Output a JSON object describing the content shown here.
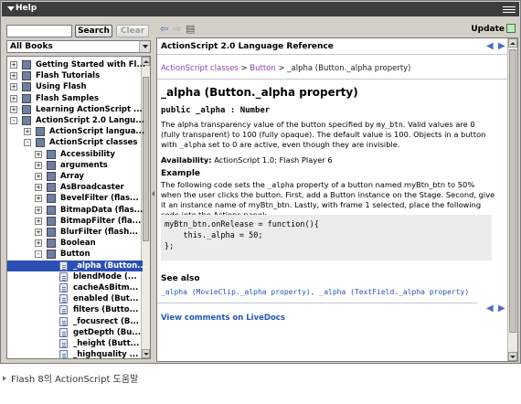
{
  "window": {
    "title": "Help"
  },
  "search": {
    "value": "",
    "search_label": "Search",
    "clear_label": "Clear"
  },
  "book_select": {
    "value": "All Books"
  },
  "tree": [
    {
      "label": "Getting Started with Fl...",
      "level": 0,
      "exp": "+",
      "icon": "book-icon"
    },
    {
      "label": "Flash Tutorials",
      "level": 0,
      "exp": "+",
      "icon": "book-icon"
    },
    {
      "label": "Using Flash",
      "level": 0,
      "exp": "+",
      "icon": "book-icon"
    },
    {
      "label": "Flash Samples",
      "level": 0,
      "exp": "+",
      "icon": "book-icon"
    },
    {
      "label": "Learning ActionScript ...",
      "level": 0,
      "exp": "+",
      "icon": "book-icon"
    },
    {
      "label": "ActionScript 2.0 Langu...",
      "level": 0,
      "exp": "-",
      "icon": "book-icon"
    },
    {
      "label": "ActionScript langua...",
      "level": 1,
      "exp": "+",
      "icon": "book-icon"
    },
    {
      "label": "ActionScript classes",
      "level": 1,
      "exp": "-",
      "icon": "book-icon"
    },
    {
      "label": "Accessibility",
      "level": 2,
      "exp": "+",
      "icon": "book-icon"
    },
    {
      "label": "arguments",
      "level": 2,
      "exp": "+",
      "icon": "book-icon"
    },
    {
      "label": "Array",
      "level": 2,
      "exp": "+",
      "icon": "book-icon"
    },
    {
      "label": "AsBroadcaster",
      "level": 2,
      "exp": "+",
      "icon": "book-icon"
    },
    {
      "label": "BevelFilter (flas...",
      "level": 2,
      "exp": "+",
      "icon": "book-icon"
    },
    {
      "label": "BitmapData (flas...",
      "level": 2,
      "exp": "+",
      "icon": "book-icon"
    },
    {
      "label": "BitmapFilter (fla...",
      "level": 2,
      "exp": "+",
      "icon": "book-icon"
    },
    {
      "label": "BlurFilter (flash...",
      "level": 2,
      "exp": "+",
      "icon": "book-icon"
    },
    {
      "label": "Boolean",
      "level": 2,
      "exp": "+",
      "icon": "book-icon"
    },
    {
      "label": "Button",
      "level": 2,
      "exp": "-",
      "icon": "book-icon"
    },
    {
      "label": "_alpha (Button...",
      "level": 3,
      "exp": "",
      "icon": "page-icon",
      "selected": true
    },
    {
      "label": "blendMode (...",
      "level": 3,
      "exp": "",
      "icon": "page-icon"
    },
    {
      "label": "cacheAsBitm...",
      "level": 3,
      "exp": "",
      "icon": "page-icon"
    },
    {
      "label": "enabled (But...",
      "level": 3,
      "exp": "",
      "icon": "page-icon"
    },
    {
      "label": "filters (Butto...",
      "level": 3,
      "exp": "",
      "icon": "page-icon"
    },
    {
      "label": "_focusrect (B...",
      "level": 3,
      "exp": "",
      "icon": "page-icon"
    },
    {
      "label": "getDepth (Bu...",
      "level": 3,
      "exp": "",
      "icon": "page-icon"
    },
    {
      "label": "_height (Butt...",
      "level": 3,
      "exp": "",
      "icon": "page-icon"
    },
    {
      "label": "_highquality ...",
      "level": 3,
      "exp": "",
      "icon": "page-icon"
    }
  ],
  "toolbar": {
    "update_label": "Update"
  },
  "doc": {
    "book_title": "ActionScript 2.0 Language Reference",
    "breadcrumb": {
      "part1": "ActionScript classes",
      "sep": ">",
      "part2": "Button",
      "current": "_alpha (Button._alpha property)"
    },
    "heading": "_alpha (Button._alpha property)",
    "signature": "public _alpha : Number",
    "desc": {
      "t1": "The alpha transparency value of the button specified by ",
      "c1": "my_btn",
      "t2": ". Valid values are 0 (fully transparent) to 100 (fully opaque). The default value is 100. Objects in a button with ",
      "c2": "_alpha",
      "t3": " set to 0 are active, even though they are invisible."
    },
    "availability_label": "Availability:",
    "availability_text": "ActionScript 1.0; Flash Player 6",
    "example_heading": "Example",
    "example": {
      "t1": "The following code sets the ",
      "c1": "_alpha",
      "t2": " property of a button named myBtn_btn to 50% when the user clicks the button. First, add a Button instance on the Stage. Second, give it an instance name of myBtn_btn. Lastly, with frame 1 selected, place the following code into the Actions panel:"
    },
    "code": "myBtn_btn.onRelease = function(){\n    this._alpha = 50;\n};",
    "see_also_heading": "See also",
    "see_also_link1": "_alpha (MovieClip._alpha property)",
    "see_also_link2": "_alpha (TextField._alpha property)",
    "see_also_sep": ", ",
    "livedocs": "View comments on LiveDocs"
  },
  "caption": "Flash 8의 ActionScript 도움말",
  "colors": {
    "selection": "#2b4fb4",
    "link": "#2456b8",
    "breadcrumb": "#8e44ad",
    "titlebar": "#3d3d3d"
  }
}
